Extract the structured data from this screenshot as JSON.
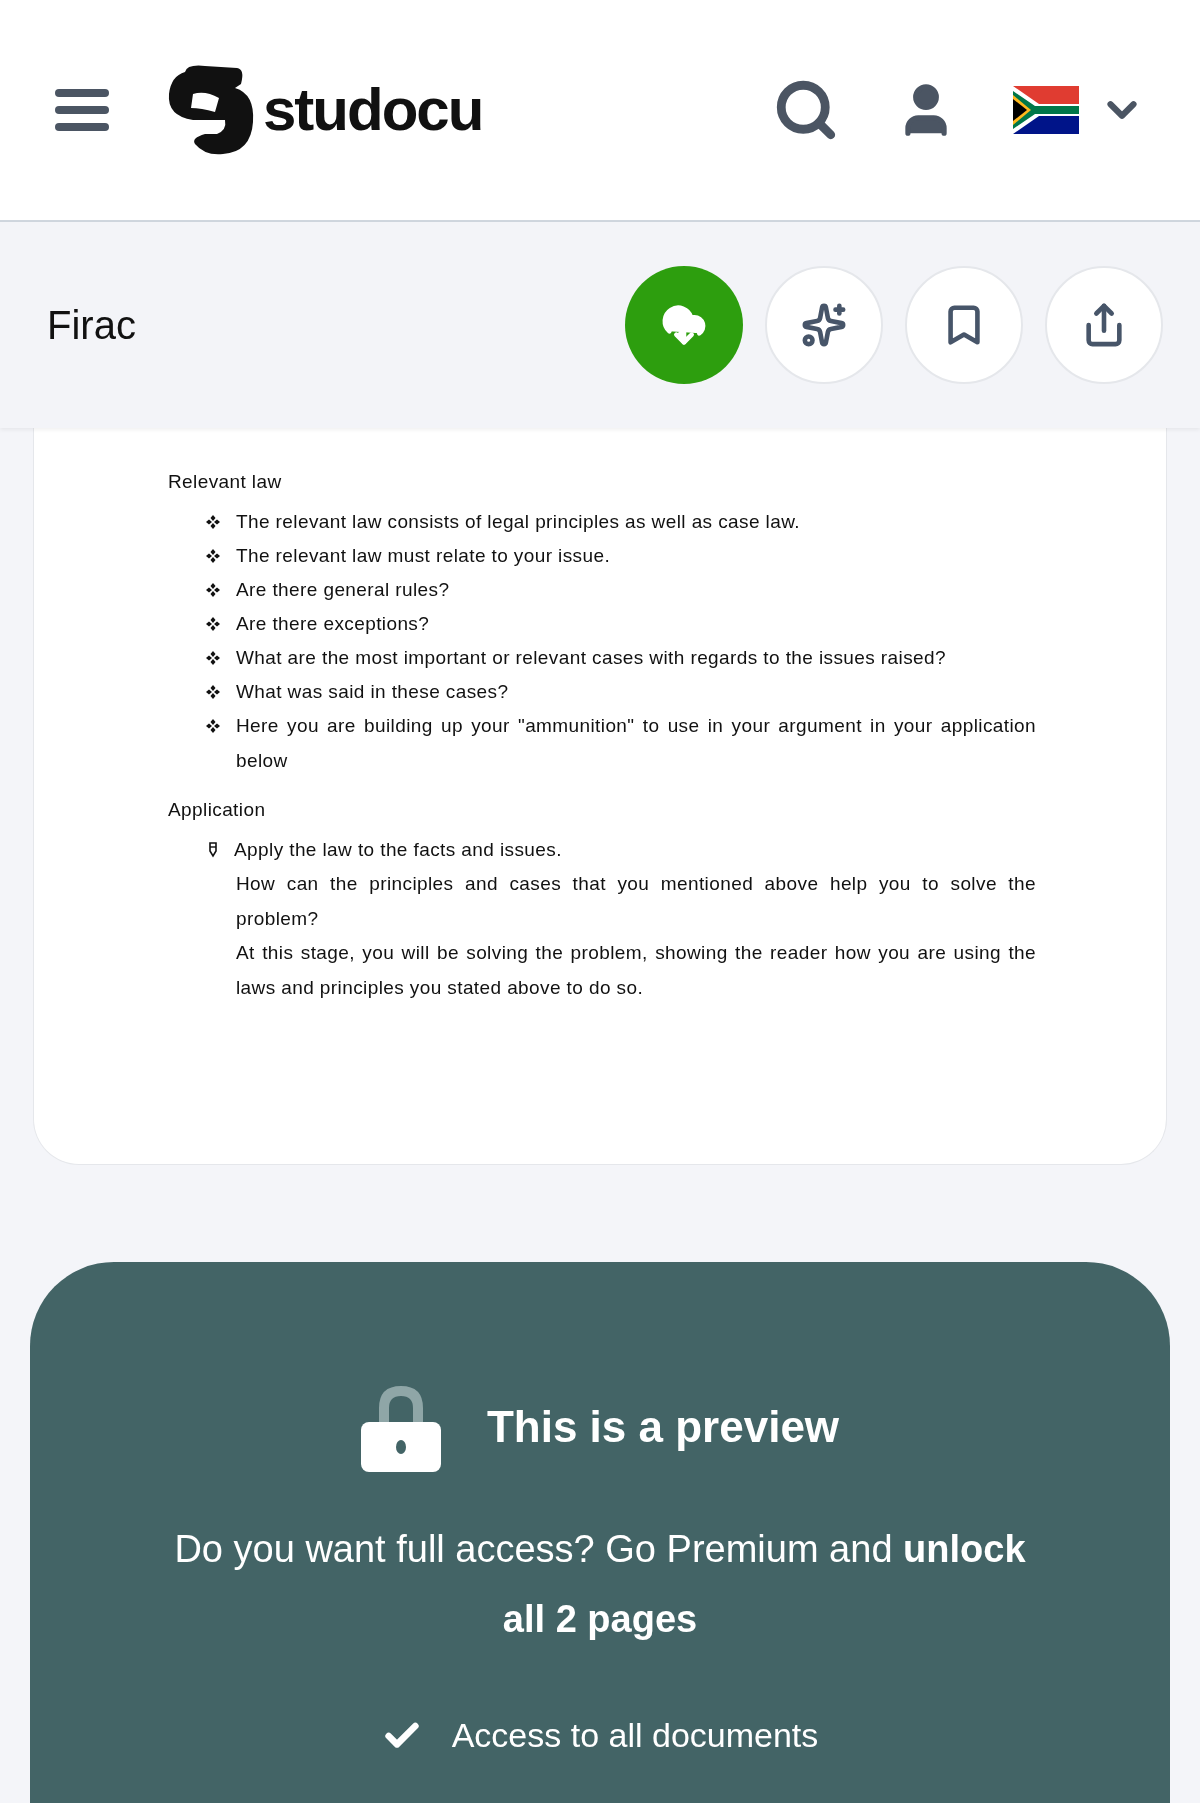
{
  "header": {
    "logo_text": "studocu"
  },
  "toolbar": {
    "title": "Firac",
    "buttons": [
      {
        "kind": "download",
        "primary": true
      },
      {
        "kind": "ai",
        "primary": false
      },
      {
        "kind": "bookmark",
        "primary": false
      },
      {
        "kind": "share",
        "primary": false
      }
    ]
  },
  "document": {
    "sections": [
      {
        "heading": "Relevant law",
        "items": [
          {
            "kind": "diamond",
            "text": "The relevant law consists of legal principles as well as case law."
          },
          {
            "kind": "diamond",
            "text": "The relevant law must relate to your issue."
          },
          {
            "kind": "diamond",
            "text": "Are there general rules?"
          },
          {
            "kind": "diamond",
            "text": "Are there exceptions?"
          },
          {
            "kind": "diamond",
            "text": "What are the most important or relevant cases with regards to the issues raised?"
          },
          {
            "kind": "diamond",
            "text": "What was said in these cases?"
          },
          {
            "kind": "diamond",
            "text": "Here you are building up your \"ammunition\" to use in your argument in your application below"
          }
        ]
      },
      {
        "heading": "Application",
        "items": [
          {
            "kind": "pen",
            "text": "Apply the law to the facts and issues."
          },
          {
            "kind": "plain",
            "text": "How can the principles and cases that you mentioned above help you to solve the problem?"
          },
          {
            "kind": "plain",
            "text": "At this stage, you will be solving the problem, showing the reader how you are using the laws and principles you stated above to do so."
          }
        ]
      }
    ]
  },
  "preview": {
    "title": "This is a preview",
    "message": "Do you want full access? Go Premium and **unlock all 2 pages**",
    "features": [
      "Access to all documents"
    ]
  }
}
